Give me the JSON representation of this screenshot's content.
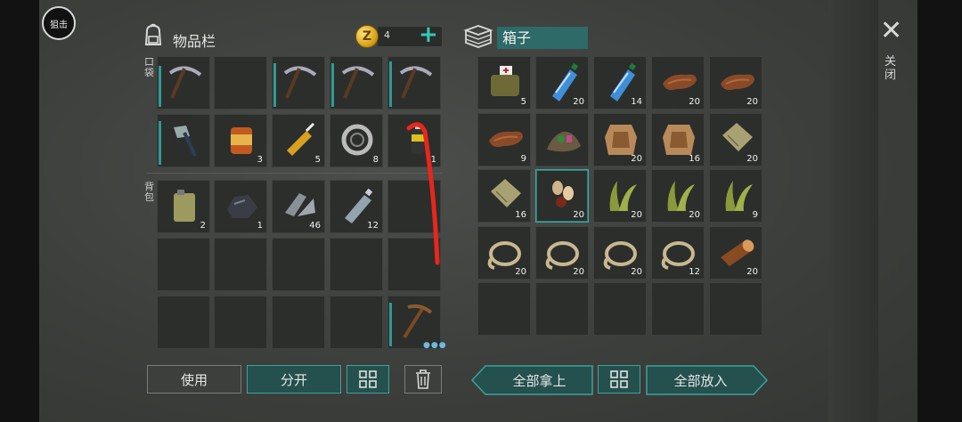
{
  "snipe_label": "狙击",
  "inventory": {
    "title": "物品栏",
    "coins": "4",
    "coin_symbol": "Z",
    "pocket_label": "口袋",
    "backpack_label": "背包",
    "pocket_row1": [
      {
        "icon": "pickaxe-icon",
        "count": "",
        "durability": 0.85
      },
      {
        "icon": "",
        "count": ""
      },
      {
        "icon": "pickaxe-icon",
        "count": "",
        "durability": 0.9
      },
      {
        "icon": "pickaxe-icon",
        "count": "",
        "durability": 0.9
      },
      {
        "icon": "pickaxe-icon",
        "count": "",
        "durability": 0.95
      }
    ],
    "pocket_row2": [
      {
        "icon": "hatchet-icon",
        "count": "",
        "durability": 0.9
      },
      {
        "icon": "canned-food-icon",
        "count": "3"
      },
      {
        "icon": "glue-icon",
        "count": "5"
      },
      {
        "icon": "bearing-icon",
        "count": "8"
      },
      {
        "icon": "spray-can-icon",
        "count": "1"
      }
    ],
    "backpack_rows": [
      [
        {
          "icon": "jerrycan-icon",
          "count": "2"
        },
        {
          "icon": "coal-icon",
          "count": "1"
        },
        {
          "icon": "scrap-metal-icon",
          "count": "46"
        },
        {
          "icon": "plastic-bottle-icon",
          "count": "12"
        },
        {
          "icon": "",
          "count": ""
        }
      ],
      [
        {
          "icon": "",
          "count": ""
        },
        {
          "icon": "",
          "count": ""
        },
        {
          "icon": "",
          "count": ""
        },
        {
          "icon": "",
          "count": ""
        },
        {
          "icon": "",
          "count": ""
        }
      ],
      [
        {
          "icon": "",
          "count": ""
        },
        {
          "icon": "",
          "count": ""
        },
        {
          "icon": "",
          "count": ""
        },
        {
          "icon": "",
          "count": ""
        },
        {
          "icon": "wooden-pickaxe-icon",
          "count": "",
          "durability": 0.9
        }
      ]
    ]
  },
  "chest": {
    "title": "箱子",
    "rows": [
      [
        {
          "icon": "first-aid-bag-icon",
          "count": "5"
        },
        {
          "icon": "water-bottle-icon",
          "count": "20"
        },
        {
          "icon": "water-bottle-icon",
          "count": "14"
        },
        {
          "icon": "leather-icon",
          "count": "20"
        },
        {
          "icon": "leather-icon",
          "count": "20"
        }
      ],
      [
        {
          "icon": "leather-icon",
          "count": "9"
        },
        {
          "icon": "garbage-pile-icon",
          "count": ""
        },
        {
          "icon": "animal-hide-icon",
          "count": "20"
        },
        {
          "icon": "animal-hide-icon",
          "count": "16"
        },
        {
          "icon": "cloth-icon",
          "count": "20"
        }
      ],
      [
        {
          "icon": "cloth-icon",
          "count": "16"
        },
        {
          "icon": "seeds-icon",
          "count": "20",
          "selected": true
        },
        {
          "icon": "plant-fiber-icon",
          "count": "20"
        },
        {
          "icon": "plant-fiber-icon",
          "count": "20"
        },
        {
          "icon": "plant-fiber-icon",
          "count": "9"
        }
      ],
      [
        {
          "icon": "rope-icon",
          "count": "20"
        },
        {
          "icon": "rope-icon",
          "count": "20"
        },
        {
          "icon": "rope-icon",
          "count": "20"
        },
        {
          "icon": "rope-icon",
          "count": "12"
        },
        {
          "icon": "log-icon",
          "count": "20"
        }
      ],
      [
        {
          "icon": "",
          "count": ""
        },
        {
          "icon": "",
          "count": ""
        },
        {
          "icon": "",
          "count": ""
        },
        {
          "icon": "",
          "count": ""
        },
        {
          "icon": "",
          "count": ""
        }
      ]
    ]
  },
  "buttons": {
    "use": "使用",
    "split": "分开",
    "take_all": "全部拿上",
    "put_all": "全部放入"
  },
  "close_label": "关闭",
  "colors": {
    "accent": "#36c7b7",
    "button_teal": "#24504e",
    "slot_bg": "#2c2e2b",
    "annotation_red": "#e8261c"
  }
}
